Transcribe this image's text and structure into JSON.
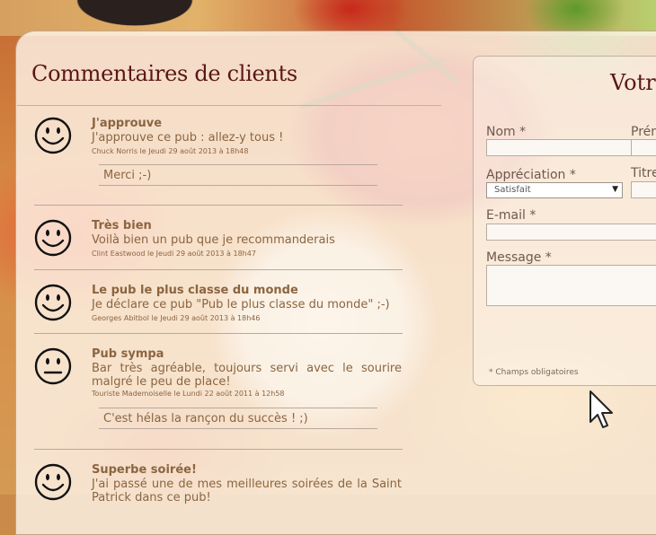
{
  "reviews_section": {
    "title": "Commentaires de clients"
  },
  "reviews": [
    {
      "mood": "happy",
      "title": "J'approuve",
      "text": "J'approuve ce pub : allez-y tous !",
      "meta": "Chuck Norris le Jeudi 29 août 2013 à 18h48",
      "reply": "Merci ;-)"
    },
    {
      "mood": "happy",
      "title": "Très bien",
      "text": "Voilà bien un pub que je recommanderais",
      "meta": "Clint Eastwood le Jeudi 29 août 2013 à 18h47",
      "reply": null
    },
    {
      "mood": "happy",
      "title": "Le pub le plus classe du monde",
      "text": "Je déclare ce pub \"Pub le plus classe du monde\" ;-)",
      "meta": "Georges Abitbol le Jeudi 29 août 2013 à 18h46",
      "reply": null
    },
    {
      "mood": "neutral",
      "title": "Pub sympa",
      "text": "Bar très agréable, toujours servi avec le sourire malgré le peu de place!",
      "meta": "Touriste Mademoiselle le Lundi 22 août 2011 à 12h58",
      "reply": "C'est hélas la rançon du succès ! ;)"
    },
    {
      "mood": "happy",
      "title": "Superbe soirée!",
      "text": "J'ai passé une de mes meilleures soirées de la Saint Patrick dans ce pub!",
      "meta": "",
      "reply": null
    }
  ],
  "form": {
    "title": "Votr",
    "name_label": "Nom *",
    "firstname_label": "Prén",
    "rating_label": "Appréciation *",
    "rating_value": "Satisfait",
    "title_label": "Titre",
    "email_label": "E-mail *",
    "message_label": "Message *",
    "required_note": "* Champs obligatoires"
  },
  "colors": {
    "heading": "#5a1616",
    "review_text": "#8b6540",
    "label": "#6d5a4c"
  }
}
